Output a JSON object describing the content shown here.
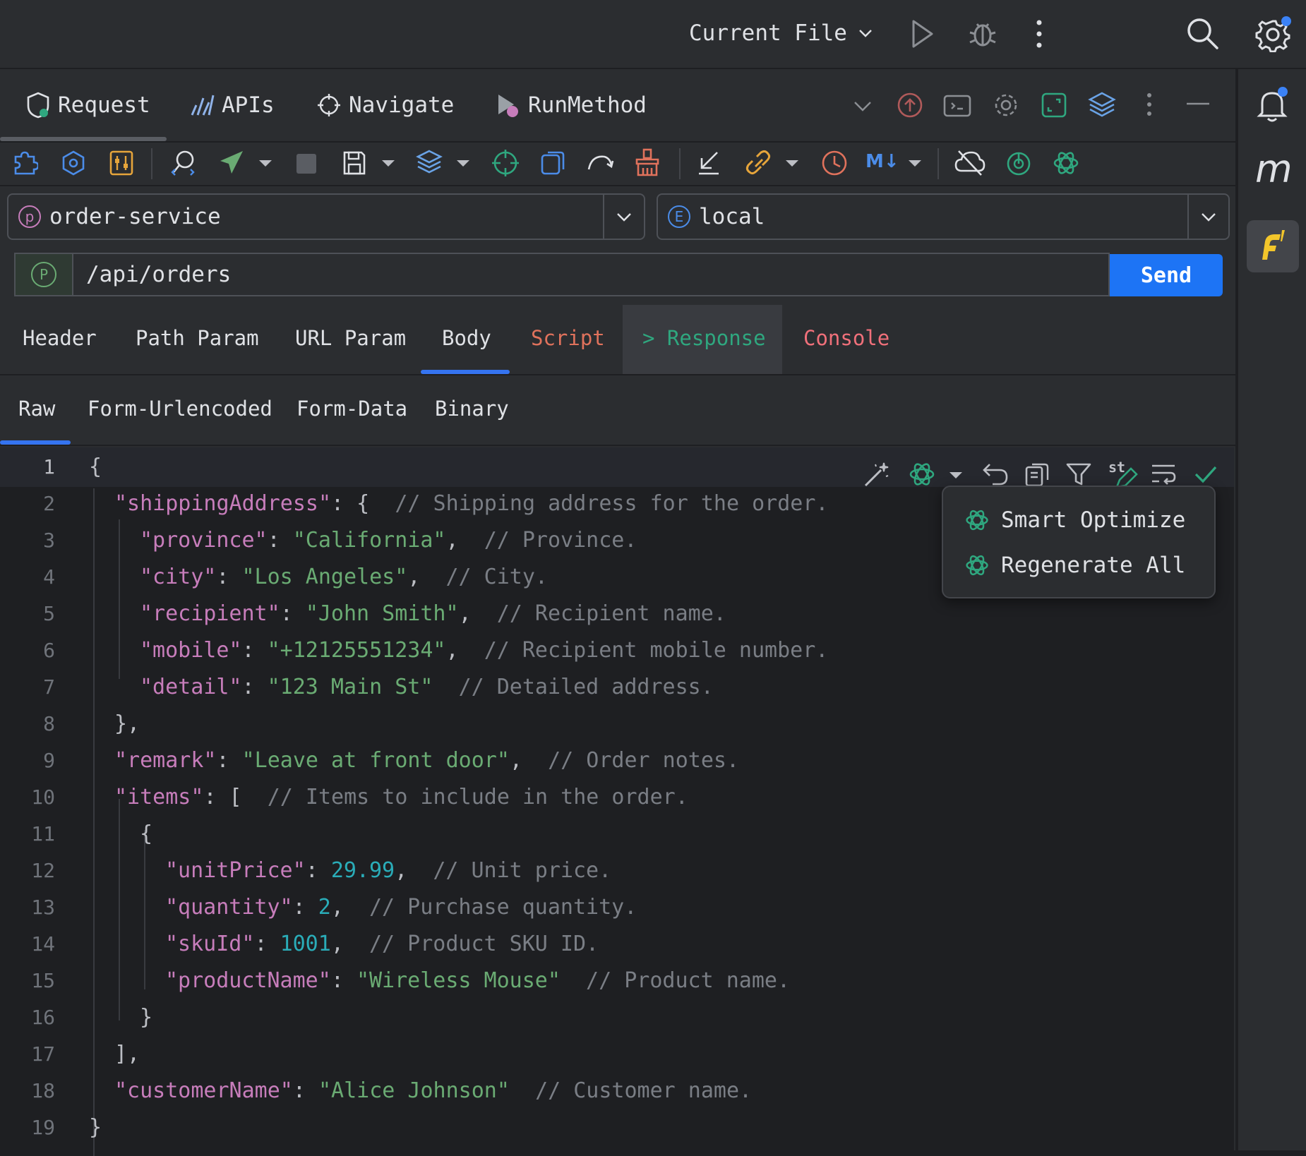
{
  "titlebar": {
    "run_config_label": "Current File"
  },
  "top_tabs": [
    {
      "label": "Request",
      "icon": "request-icon"
    },
    {
      "label": "APIs",
      "icon": "apis-icon"
    },
    {
      "label": "Navigate",
      "icon": "navigate-icon"
    },
    {
      "label": "RunMethod",
      "icon": "run-method-icon"
    }
  ],
  "project_select": {
    "badge": "p",
    "value": "order-service"
  },
  "env_select": {
    "badge": "E",
    "value": "local"
  },
  "url": {
    "badge": "P",
    "value": "/api/orders"
  },
  "send_label": "Send",
  "request_tabs": [
    "Header",
    "Path Param",
    "URL Param",
    "Body",
    "Script",
    "> Response",
    "Console"
  ],
  "body_tabs": [
    "Raw",
    "Form-Urlencoded",
    "Form-Data",
    "Binary"
  ],
  "toolbar_badge": "M↓",
  "editor_st_label": "st",
  "right_strip": {
    "m_label": "m"
  },
  "ai_menu": {
    "items": [
      "Smart Optimize",
      "Regenerate All"
    ]
  },
  "editor": {
    "line_numbers": [
      "1",
      "2",
      "3",
      "4",
      "5",
      "6",
      "7",
      "8",
      "9",
      "10",
      "11",
      "12",
      "13",
      "14",
      "15",
      "16",
      "17",
      "18",
      "19"
    ],
    "lines": [
      {
        "p1": "{"
      },
      {
        "k": "\"shippingAddress\"",
        "p1": ": {  ",
        "c": "// Shipping address for the order."
      },
      {
        "k": "\"province\"",
        "p1": ": ",
        "s": "\"California\"",
        "p2": ",  ",
        "c": "// Province."
      },
      {
        "k": "\"city\"",
        "p1": ": ",
        "s": "\"Los Angeles\"",
        "p2": ",  ",
        "c": "// City."
      },
      {
        "k": "\"recipient\"",
        "p1": ": ",
        "s": "\"John Smith\"",
        "p2": ",  ",
        "c": "// Recipient name."
      },
      {
        "k": "\"mobile\"",
        "p1": ": ",
        "s": "\"+12125551234\"",
        "p2": ",  ",
        "c": "// Recipient mobile number."
      },
      {
        "k": "\"detail\"",
        "p1": ": ",
        "s": "\"123 Main St\"",
        "p2": "  ",
        "c": "// Detailed address."
      },
      {
        "p1": "},"
      },
      {
        "k": "\"remark\"",
        "p1": ": ",
        "s": "\"Leave at front door\"",
        "p2": ",  ",
        "c": "// Order notes."
      },
      {
        "k": "\"items\"",
        "p1": ": [  ",
        "c": "// Items to include in the order."
      },
      {
        "p1": "{"
      },
      {
        "k": "\"unitPrice\"",
        "p1": ": ",
        "n": "29.99",
        "p2": ",  ",
        "c": "// Unit price."
      },
      {
        "k": "\"quantity\"",
        "p1": ": ",
        "n": "2",
        "p2": ",  ",
        "c": "// Purchase quantity."
      },
      {
        "k": "\"skuId\"",
        "p1": ": ",
        "n": "1001",
        "p2": ",  ",
        "c": "// Product SKU ID."
      },
      {
        "k": "\"productName\"",
        "p1": ": ",
        "s": "\"Wireless Mouse\"",
        "p2": "  ",
        "c": "// Product name."
      },
      {
        "p1": "}"
      },
      {
        "p1": "],"
      },
      {
        "k": "\"customerName\"",
        "p1": ": ",
        "s": "\"Alice Johnson\"",
        "p2": "  ",
        "c": "// Customer name."
      },
      {
        "p1": "}"
      }
    ]
  },
  "colors": {
    "send_button": "#1d74f5",
    "response_tab": "#2fa77f",
    "script_tab": "#e0725c",
    "console_tab": "#f0707a",
    "accent_underline": "#3574f0",
    "plugin_icon_bg": "#f3c62b"
  }
}
